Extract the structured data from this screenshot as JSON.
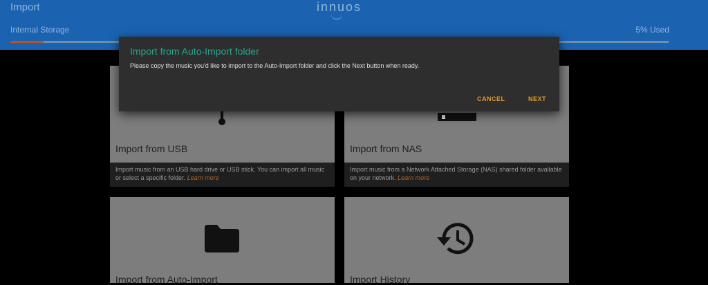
{
  "header": {
    "title": "Import",
    "logo_text": "innuos",
    "storage_label": "Internal Storage",
    "storage_used": "5% Used",
    "storage_percent": 5,
    "accent_color": "#1b63b0"
  },
  "cards": {
    "usb": {
      "title": "Import from USB",
      "description": "Import music from an USB hard drive or USB stick. You can import all music or select a specific folder.",
      "link": "Learn more",
      "icon": "usb-icon"
    },
    "nas": {
      "title": "Import from NAS",
      "description": "Import music from a Network Attached Storage (NAS) shared folder available on your network.",
      "link": "Learn more",
      "icon": "nas-icon"
    },
    "auto_import": {
      "title": "Import from Auto-Import",
      "icon": "folder-icon"
    },
    "history": {
      "title": "Import History",
      "icon": "history-icon"
    }
  },
  "dialog": {
    "title": "Import from Auto-Import folder",
    "body": "Please copy the music you'd like to import to the Auto-Import folder and click the Next button when ready.",
    "cancel_label": "CANCEL",
    "next_label": "NEXT",
    "title_color": "#26a593",
    "button_color": "#e39a2c"
  }
}
